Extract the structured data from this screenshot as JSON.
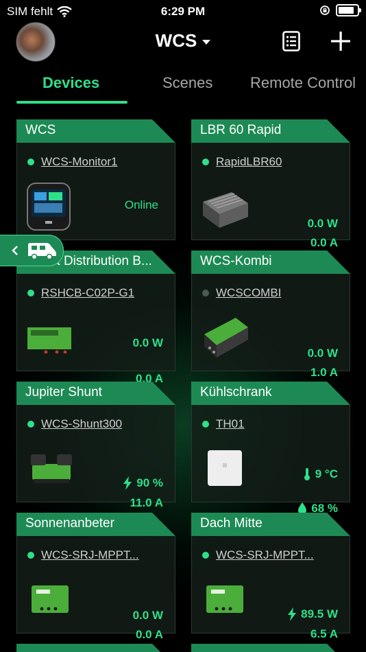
{
  "status_bar": {
    "carrier": "SIM fehlt",
    "time": "6:29 PM"
  },
  "header": {
    "title": "WCS"
  },
  "tabs": [
    {
      "label": "Devices",
      "active": true
    },
    {
      "label": "Scenes",
      "active": false
    },
    {
      "label": "Remote Control",
      "active": false
    }
  ],
  "devices": [
    {
      "name": "WCS",
      "device_id": "WCS-Monitor1",
      "online": true,
      "status": "Online"
    },
    {
      "name": "LBR 60 Rapid",
      "device_id": "RapidLBR60",
      "online": true,
      "value1": "0.0 W",
      "value2": "0.0 A"
    },
    {
      "name": "Smart Distribution B...",
      "device_id": "RSHCB-C02P-G1",
      "online": true,
      "value1": "0.0 W",
      "value2": "0.0 A"
    },
    {
      "name": "WCS-Kombi",
      "device_id": "WCSCOMBI",
      "online": false,
      "value1": "0.0 W",
      "value2": "1.0 A"
    },
    {
      "name": "Jupiter Shunt",
      "device_id": "WCS-Shunt300",
      "online": true,
      "value1": "90 %",
      "value2": "11.0 A"
    },
    {
      "name": "Kühlschrank",
      "device_id": "TH01",
      "online": true,
      "value1": "9 °C",
      "value2": "68 %"
    },
    {
      "name": "Sonnenanbeter",
      "device_id": "WCS-SRJ-MPPT...",
      "online": true,
      "value1": "0.0 W",
      "value2": "0.0 A"
    },
    {
      "name": "Dach Mitte",
      "device_id": "WCS-SRJ-MPPT...",
      "online": true,
      "value1": "89.5 W",
      "value2": "6.5 A"
    }
  ],
  "colors": {
    "accent": "#2fe08a",
    "card_head": "#1d8a55",
    "background": "#000000"
  },
  "icons": [
    "wifi-icon",
    "lock-rotation-icon",
    "battery-icon",
    "chevron-down-icon",
    "list-icon",
    "plus-icon",
    "chevron-left-icon",
    "camper-icon",
    "bolt-icon",
    "thermometer-icon",
    "droplet-icon"
  ]
}
